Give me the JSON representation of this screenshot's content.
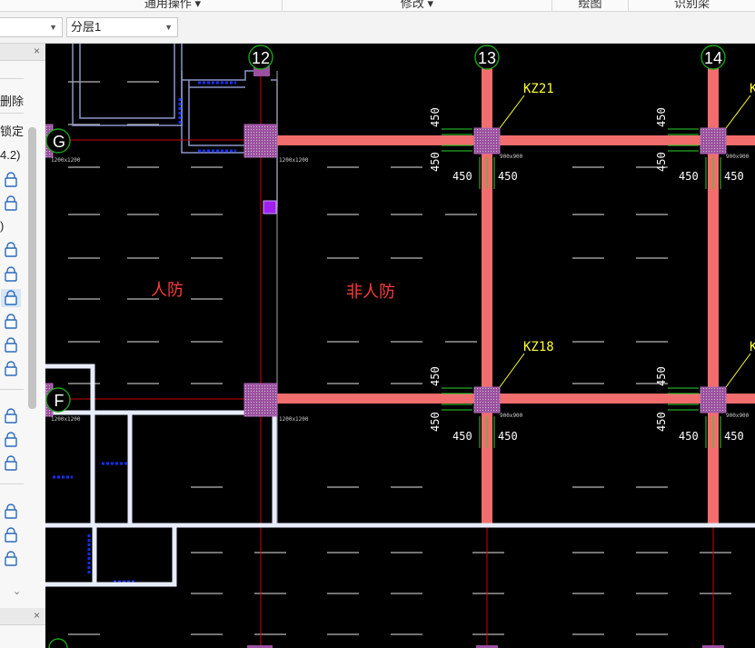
{
  "ribbon": {
    "groups": [
      "通用操作",
      "修改",
      "绘图",
      "识别梁"
    ]
  },
  "toolbar": {
    "combo1": "",
    "combo2": "分层1"
  },
  "left_panel": {
    "close_glyph": "×",
    "delete_label": "删除",
    "lock_label": "锁定",
    "item_version": "4.2)",
    "item_paren": ")",
    "scroll_down_glyph": "⌄"
  },
  "canvas": {
    "axes": [
      {
        "label": "12"
      },
      {
        "label": "13"
      },
      {
        "label": "14"
      },
      {
        "label": "G"
      },
      {
        "label": "F"
      }
    ],
    "column_labels": {
      "kz21": "KZ21",
      "kz18": "KZ18",
      "cut": "K"
    },
    "zone_labels": {
      "civil_defense": "人防",
      "non_civil_defense": "非人防"
    },
    "dimension": "450",
    "column_size_small": "900x900",
    "column_size_large": "1200x1200",
    "colors": {
      "background": "#000000",
      "beam": "#f26d6d",
      "column": "#9b4fa0",
      "wall": "#e8ecff",
      "axis_line": "#d00000",
      "axis_bubble": "#1aa31a",
      "dimension": "#2bd12b",
      "label": "#ffff33",
      "zone_text": "#ff3b3b",
      "blue_wall": "#1030ff"
    }
  }
}
